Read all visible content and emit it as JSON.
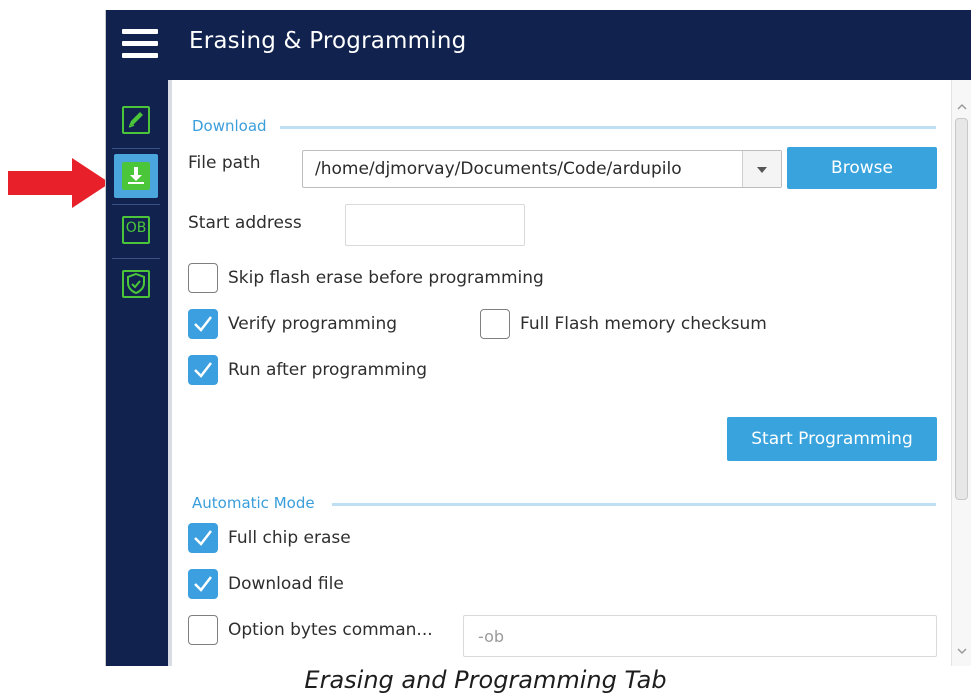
{
  "window": {
    "title": "Erasing & Programming"
  },
  "sidebar": {
    "items": [
      {
        "name": "edit",
        "icon": "edit-memory-icon",
        "active": false
      },
      {
        "name": "download",
        "icon": "download-icon",
        "active": true
      },
      {
        "name": "option-bytes",
        "icon": "option-bytes-icon",
        "label": "OB",
        "active": false
      },
      {
        "name": "security",
        "icon": "shield-icon",
        "active": false
      }
    ]
  },
  "download": {
    "section_title": "Download",
    "file_path_label": "File path",
    "file_path_value": "/home/djmorvay/Documents/Code/ardupilo",
    "browse_label": "Browse",
    "start_address_label": "Start address",
    "start_address_value": "",
    "skip_erase_label": "Skip flash erase before programming",
    "skip_erase_checked": false,
    "verify_label": "Verify programming",
    "verify_checked": true,
    "checksum_label": "Full Flash memory checksum",
    "checksum_checked": false,
    "run_after_label": "Run after programming",
    "run_after_checked": true,
    "start_button_label": "Start Programming"
  },
  "automatic_mode": {
    "section_title": "Automatic Mode",
    "full_chip_erase_label": "Full chip erase",
    "full_chip_erase_checked": true,
    "download_file_label": "Download file",
    "download_file_checked": true,
    "option_bytes_label": "Option bytes comman...",
    "option_bytes_checked": false,
    "option_bytes_placeholder": "-ob"
  },
  "caption": "Erasing and Programming Tab",
  "colors": {
    "header_bg": "#10224d",
    "accent": "#38a3dc",
    "icon_green": "#4bc63a",
    "annotation_arrow": "#e8202a"
  }
}
